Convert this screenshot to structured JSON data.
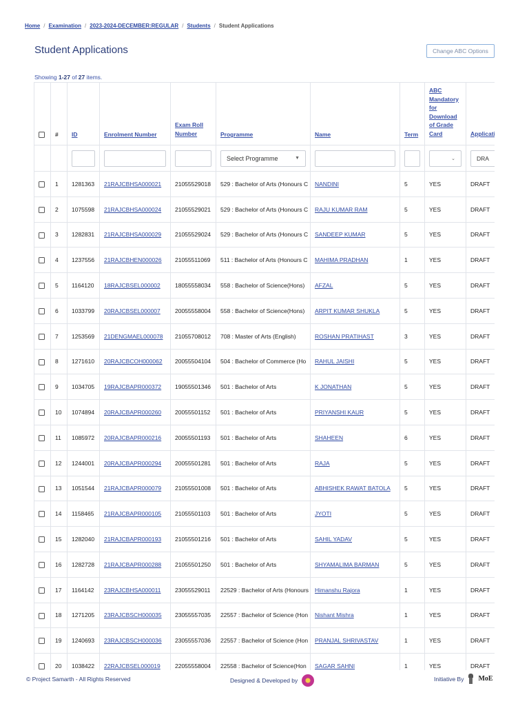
{
  "breadcrumb": {
    "items": [
      "Home",
      "Examination",
      "2023-2024-DECEMBER:REGULAR",
      "Students"
    ],
    "current": "Student Applications"
  },
  "page": {
    "title": "Student Applications",
    "change_abc_label": "Change ABC Options",
    "summary_prefix": "Showing ",
    "summary_range": "1-27",
    "summary_mid": " of ",
    "summary_total": "27",
    "summary_suffix": " items."
  },
  "table": {
    "headers": {
      "index": "#",
      "id": "ID",
      "enrolment": "Enrolment Number",
      "exam_roll": "Exam Roll Number",
      "programme": "Programme",
      "name": "Name",
      "term": "Term",
      "abc": "ABC Mandatory for Download of Grade Card",
      "status": "Application Status"
    },
    "filters": {
      "programme_placeholder": "Select Programme",
      "status_value": "DRA"
    },
    "rows": [
      {
        "n": "1",
        "id": "1281363",
        "enrol": "21RAJCBHSA000021",
        "roll": "21055529018",
        "prog": "529 : Bachelor of Arts (Honours C",
        "name": "NANDINI",
        "term": "5",
        "abc": "YES",
        "status": "DRAFT"
      },
      {
        "n": "2",
        "id": "1075598",
        "enrol": "21RAJCBHSA000024",
        "roll": "21055529021",
        "prog": "529 : Bachelor of Arts (Honours C",
        "name": "RAJU KUMAR RAM",
        "term": "5",
        "abc": "YES",
        "status": "DRAFT"
      },
      {
        "n": "3",
        "id": "1282831",
        "enrol": "21RAJCBHSA000029",
        "roll": "21055529024",
        "prog": "529 : Bachelor of Arts (Honours C",
        "name": "SANDEEP KUMAR",
        "term": "5",
        "abc": "YES",
        "status": "DRAFT"
      },
      {
        "n": "4",
        "id": "1237556",
        "enrol": "21RAJCBHEN000026",
        "roll": "21055511069",
        "prog": "511 : Bachelor of Arts (Honours C",
        "name": "MAHIMA PRADHAN",
        "term": "1",
        "abc": "YES",
        "status": "DRAFT"
      },
      {
        "n": "5",
        "id": "1164120",
        "enrol": "18RAJCBSEL000002",
        "roll": "18055558034",
        "prog": "558 : Bachelor of Science(Hons)",
        "name": "AFZAL",
        "term": "5",
        "abc": "YES",
        "status": "DRAFT"
      },
      {
        "n": "6",
        "id": "1033799",
        "enrol": "20RAJCBSEL000007",
        "roll": "20055558004",
        "prog": "558 : Bachelor of Science(Hons)",
        "name": "ARPIT KUMAR SHUKLA",
        "term": "5",
        "abc": "YES",
        "status": "DRAFT"
      },
      {
        "n": "7",
        "id": "1253569",
        "enrol": "21DENGMAEL000078",
        "roll": "21055708012",
        "prog": "708 : Master of Arts (English)",
        "name": "ROSHAN PRATIHAST",
        "term": "3",
        "abc": "YES",
        "status": "DRAFT"
      },
      {
        "n": "8",
        "id": "1271610",
        "enrol": "20RAJCBCOH000062",
        "roll": "20055504104",
        "prog": "504 : Bachelor of Commerce (Ho",
        "name": "RAHUL JAISHI",
        "term": "5",
        "abc": "YES",
        "status": "DRAFT"
      },
      {
        "n": "9",
        "id": "1034705",
        "enrol": "19RAJCBAPR000372",
        "roll": "19055501346",
        "prog": "501 : Bachelor of Arts",
        "name": "K JONATHAN",
        "term": "5",
        "abc": "YES",
        "status": "DRAFT"
      },
      {
        "n": "10",
        "id": "1074894",
        "enrol": "20RAJCBAPR000260",
        "roll": "20055501152",
        "prog": "501 : Bachelor of Arts",
        "name": "PRIYANSHI KAUR",
        "term": "5",
        "abc": "YES",
        "status": "DRAFT"
      },
      {
        "n": "11",
        "id": "1085972",
        "enrol": "20RAJCBAPR000216",
        "roll": "20055501193",
        "prog": "501 : Bachelor of Arts",
        "name": "SHAHEEN",
        "term": "6",
        "abc": "YES",
        "status": "DRAFT"
      },
      {
        "n": "12",
        "id": "1244001",
        "enrol": "20RAJCBAPR000294",
        "roll": "20055501281",
        "prog": "501 : Bachelor of Arts",
        "name": "RAJA",
        "term": "5",
        "abc": "YES",
        "status": "DRAFT"
      },
      {
        "n": "13",
        "id": "1051544",
        "enrol": "21RAJCBAPR000079",
        "roll": "21055501008",
        "prog": "501 : Bachelor of Arts",
        "name": "ABHISHEK RAWAT BATOLA",
        "term": "5",
        "abc": "YES",
        "status": "DRAFT"
      },
      {
        "n": "14",
        "id": "1158465",
        "enrol": "21RAJCBAPR000105",
        "roll": "21055501103",
        "prog": "501 : Bachelor of Arts",
        "name": "JYOTI",
        "term": "5",
        "abc": "YES",
        "status": "DRAFT"
      },
      {
        "n": "15",
        "id": "1282040",
        "enrol": "21RAJCBAPR000193",
        "roll": "21055501216",
        "prog": "501 : Bachelor of Arts",
        "name": "SAHIL YADAV",
        "term": "5",
        "abc": "YES",
        "status": "DRAFT"
      },
      {
        "n": "16",
        "id": "1282728",
        "enrol": "21RAJCBAPR000288",
        "roll": "21055501250",
        "prog": "501 : Bachelor of Arts",
        "name": "SHYAMALIMA BARMAN",
        "term": "5",
        "abc": "YES",
        "status": "DRAFT"
      },
      {
        "n": "17",
        "id": "1164142",
        "enrol": "23RAJCBHSA000011",
        "roll": "23055529011",
        "prog": "22529 : Bachelor of Arts (Honours",
        "name": "Himanshu Rajora",
        "term": "1",
        "abc": "YES",
        "status": "DRAFT"
      },
      {
        "n": "18",
        "id": "1271205",
        "enrol": "23RAJCBSCH000035",
        "roll": "23055557035",
        "prog": "22557 : Bachelor of Science (Hon",
        "name": "Nishant Mishra",
        "term": "1",
        "abc": "YES",
        "status": "DRAFT"
      },
      {
        "n": "19",
        "id": "1240693",
        "enrol": "23RAJCBSCH000036",
        "roll": "23055557036",
        "prog": "22557 : Bachelor of Science (Hon",
        "name": "PRANJAL SHRIVASTAV",
        "term": "1",
        "abc": "YES",
        "status": "DRAFT"
      },
      {
        "n": "20",
        "id": "1038422",
        "enrol": "22RAJCBSEL000019",
        "roll": "22055558004",
        "prog": "22558 : Bachelor of Science(Hon",
        "name": "SAGAR SAHNI",
        "term": "1",
        "abc": "YES",
        "status": "DRAFT"
      }
    ]
  },
  "footer": {
    "copyright": "© Project Samarth - All Rights Reserved",
    "designed_by": "Designed & Developed by",
    "initiative_by": "Initiative By",
    "moe": "MoE"
  }
}
